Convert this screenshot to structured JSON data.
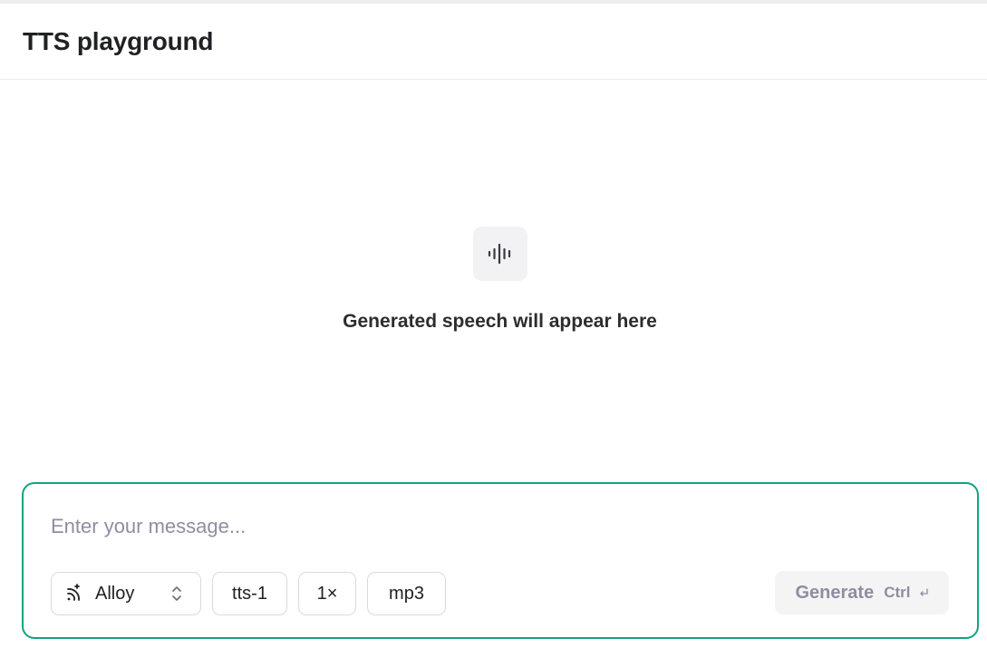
{
  "header": {
    "title": "TTS playground"
  },
  "empty_state": {
    "icon": "audio-waveform-icon",
    "text": "Generated speech will appear here"
  },
  "composer": {
    "placeholder": "Enter your message...",
    "value": "",
    "voice": {
      "label": "Alloy",
      "icon": "voice-waves-icon"
    },
    "model": "tts-1",
    "speed": "1×",
    "format": "mp3",
    "generate": {
      "label": "Generate",
      "shortcut": "Ctrl",
      "shortcut_icon": "enter-key-icon"
    }
  },
  "colors": {
    "accent": "#10a37f",
    "border": "#d9d9e3",
    "disabled_text": "#8e8ea0",
    "placeholder": "#8e8ea0"
  }
}
